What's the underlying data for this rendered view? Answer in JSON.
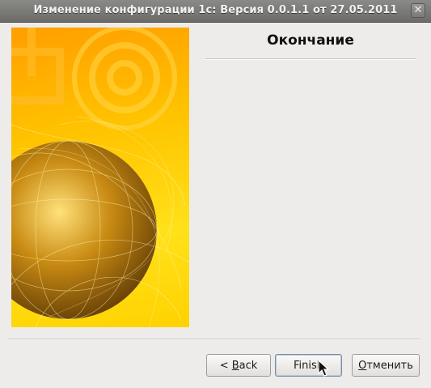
{
  "window": {
    "title": "Изменение конфигурации 1с:  Версия 0.0.1.1 от 27.05.2011",
    "close_glyph": "✕"
  },
  "page": {
    "title": "Окончание"
  },
  "buttons": {
    "back_prefix": "< ",
    "back_mnemonic": "B",
    "back_rest": "ack",
    "finish_label": "Finish",
    "cancel_mnemonic": "О",
    "cancel_rest": "тменить"
  },
  "colors": {
    "image_orange": "#ff9e00",
    "image_yellow": "#ffe11a",
    "globe_gold": "#c88a12"
  }
}
